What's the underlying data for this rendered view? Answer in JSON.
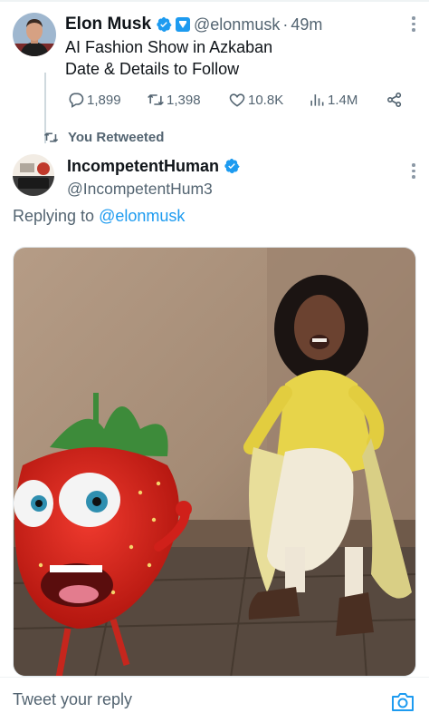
{
  "colors": {
    "accent": "#1d9bf0",
    "text": "#0f1419",
    "muted": "#536471",
    "border": "#eff3f4"
  },
  "parent_tweet": {
    "display_name": "Elon Musk",
    "handle": "@elonmusk",
    "separator": "·",
    "time": "49m",
    "text_line1": "AI Fashion Show in Azkaban",
    "text_line2": "Date & Details to Follow",
    "replies": "1,899",
    "retweets": "1,398",
    "likes": "10.8K",
    "views": "1.4M",
    "icons": [
      "verified-badge-icon",
      "affiliate-badge-icon",
      "more-icon",
      "reply-icon",
      "retweet-icon",
      "like-icon",
      "views-icon",
      "share-icon"
    ]
  },
  "retweet_banner": {
    "label": "You Retweeted",
    "icon": "retweet-icon"
  },
  "reply_tweet": {
    "display_name": "IncompetentHuman",
    "handle": "@IncompetentHum3",
    "replying_prefix": "Replying to",
    "replying_handle": "@elonmusk"
  },
  "composer": {
    "placeholder": "Tweet your reply",
    "icon": "camera-icon"
  }
}
